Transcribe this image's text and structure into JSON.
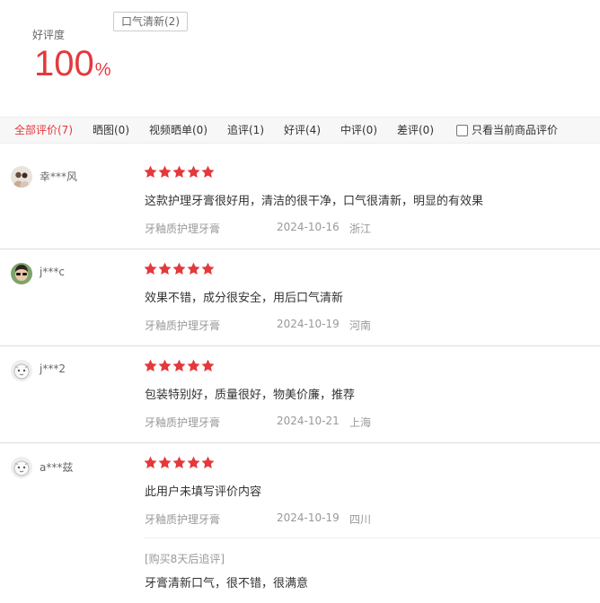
{
  "summary": {
    "label": "好评度",
    "value": "100",
    "unit": "%",
    "tags": [
      "口气清新(2)"
    ]
  },
  "filters": {
    "tabs": [
      "全部评价(7)",
      "晒图(0)",
      "视频晒单(0)",
      "追评(1)",
      "好评(4)",
      "中评(0)",
      "差评(0)"
    ],
    "active_index": 0,
    "only_current_label": "只看当前商品评价",
    "only_current_checked": false
  },
  "colors": {
    "accent": "#e4393c",
    "star": "#e4393c"
  },
  "reviews": [
    {
      "user": "幸***风",
      "avatar": "avatar-couple-photo",
      "stars": 5,
      "content": "这款护理牙膏很好用，清洁的很干净，口气很清新，明显的有效果",
      "product": "牙釉质护理牙膏",
      "date": "2024-10-16",
      "region": "浙江"
    },
    {
      "user": "j***c",
      "avatar": "avatar-sunglasses-photo",
      "stars": 5,
      "content": "效果不错，成分很安全，用后口气清新",
      "product": "牙釉质护理牙膏",
      "date": "2024-10-19",
      "region": "河南"
    },
    {
      "user": "j***2",
      "avatar": "avatar-default-cartoon",
      "stars": 5,
      "content": "包装特别好，质量很好，物美价廉，推荐",
      "product": "牙釉质护理牙膏",
      "date": "2024-10-21",
      "region": "上海"
    },
    {
      "user": "a***兹",
      "avatar": "avatar-default-cartoon",
      "stars": 5,
      "content": "此用户未填写评价内容",
      "product": "牙釉质护理牙膏",
      "date": "2024-10-19",
      "region": "四川",
      "append": {
        "label": "[购买8天后追评]",
        "content": "牙膏清新口气，很不错，很满意"
      }
    }
  ]
}
